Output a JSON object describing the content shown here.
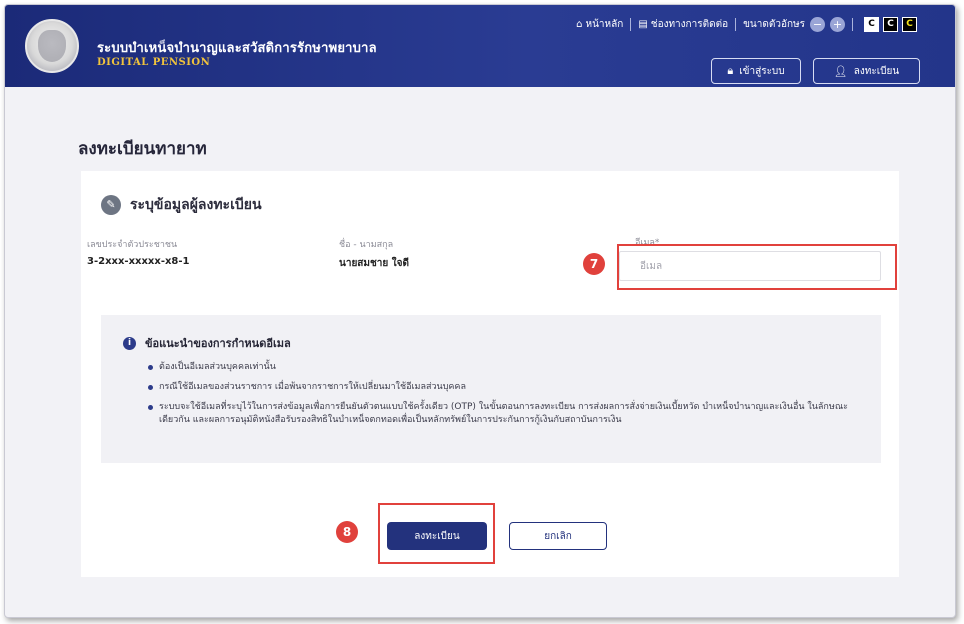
{
  "header": {
    "system_title": "ระบบบำเหน็จบำนาญและสวัสดิการรักษาพยาบาล",
    "system_subtitle": "DIGITAL PENSION",
    "nav": {
      "home": "หน้าหลัก",
      "contact": "ช่องทางการติดต่อ",
      "font_size": "ขนาดตัวอักษร",
      "zoom_out": "−",
      "zoom_in": "+",
      "contrast_labels": [
        "C",
        "C",
        "C"
      ]
    },
    "login_button": "เข้าสู่ระบบ",
    "register_button": "ลงทะเบียน"
  },
  "page_title": "ลงทะเบียนทายาท",
  "form": {
    "section_title": "ระบุข้อมูลผู้ลงทะเบียน",
    "id_label": "เลขประจำตัวประชาชน",
    "id_value": "3-2xxx-xxxxx-x8-1",
    "name_label": "ชื่อ - นามสกุล",
    "name_value": "นายสมชาย ใจดี",
    "email_label": "อีเมล*",
    "email_placeholder": "อีเมล",
    "email_value": ""
  },
  "advice": {
    "title": "ข้อแนะนำของการกำหนดอีเมล",
    "items": [
      "ต้องเป็นอีเมลส่วนบุคคลเท่านั้น",
      "กรณีใช้อีเมลของส่วนราชการ เมื่อพ้นจากราชการให้เปลี่ยนมาใช้อีเมลส่วนบุคคล",
      "ระบบจะใช้อีเมลที่ระบุไว้ในการส่งข้อมูลเพื่อการยืนยันตัวตนแบบใช้ครั้งเดียว (OTP) ในขั้นตอนการลงทะเบียน การส่งผลการสั่งจ่ายเงินเบี้ยหวัด บำเหน็จบำนาญและเงินอื่น ในลักษณะเดียวกัน และผลการอนุมัติหนังสือรับรองสิทธิในบำเหน็จตกทอดเพื่อเป็นหลักทรัพย์ในการประกันการกู้เงินกับสถาบันการเงิน"
    ]
  },
  "actions": {
    "submit": "ลงทะเบียน",
    "cancel": "ยกเลิก"
  },
  "annotations": {
    "marker_email": "7",
    "marker_submit": "8"
  },
  "colors": {
    "header_bg": "#1f2f80",
    "primary": "#23327d",
    "highlight": "#e1413c",
    "subtitle_gold": "#f0c33c"
  }
}
